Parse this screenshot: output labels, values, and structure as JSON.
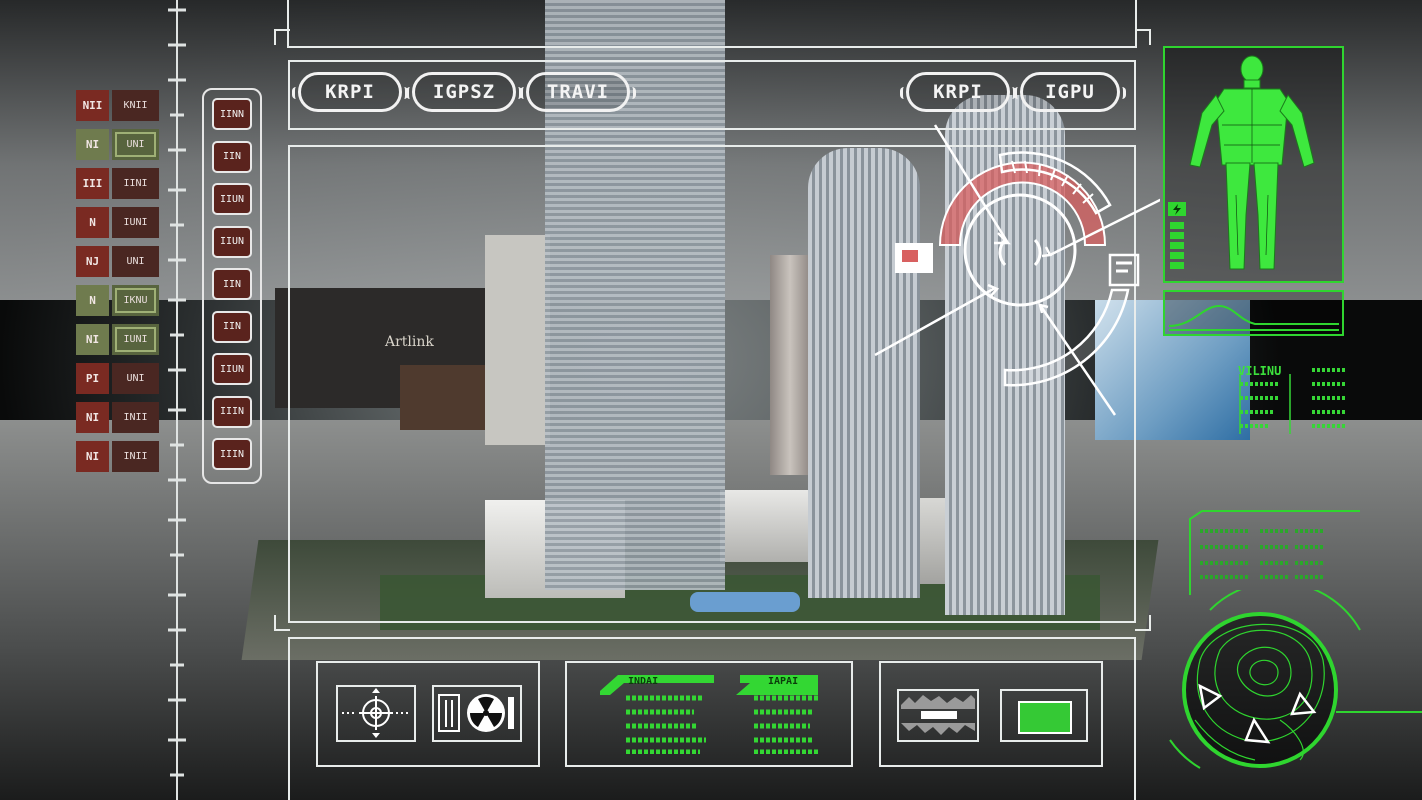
{
  "top_tabs_left": [
    "KRPI",
    "IGPSZ",
    "TRAVI"
  ],
  "top_tabs_right": [
    "KRPI",
    "IGPU"
  ],
  "left_panel": {
    "red_labels": [
      "NII",
      "NI",
      "III",
      "N",
      "NJ",
      "N",
      "NI",
      "PI",
      "NI",
      "NI"
    ],
    "dark_labels": [
      "KNII",
      "UNI",
      "IINI",
      "IUNI",
      "UNI",
      "IKNU",
      "IUNI",
      "UNI",
      "INII",
      "INII"
    ],
    "highlighted_rows": [
      1,
      5,
      6
    ]
  },
  "vertical_list": [
    "IINN",
    "IIN",
    "IIUN",
    "IIUN",
    "IIN",
    "IIN",
    "IIUN",
    "IIIN",
    "IIIN"
  ],
  "bottom_panel": {
    "status_tags": [
      "INDAI",
      "IAPAI"
    ]
  },
  "right_panel": {
    "energy_level": 0.83,
    "stat_header": "VILINU",
    "accent_color": "#2fd52f",
    "alert_color": "#d86060"
  },
  "scene": {
    "sign_text": "Artlink"
  }
}
